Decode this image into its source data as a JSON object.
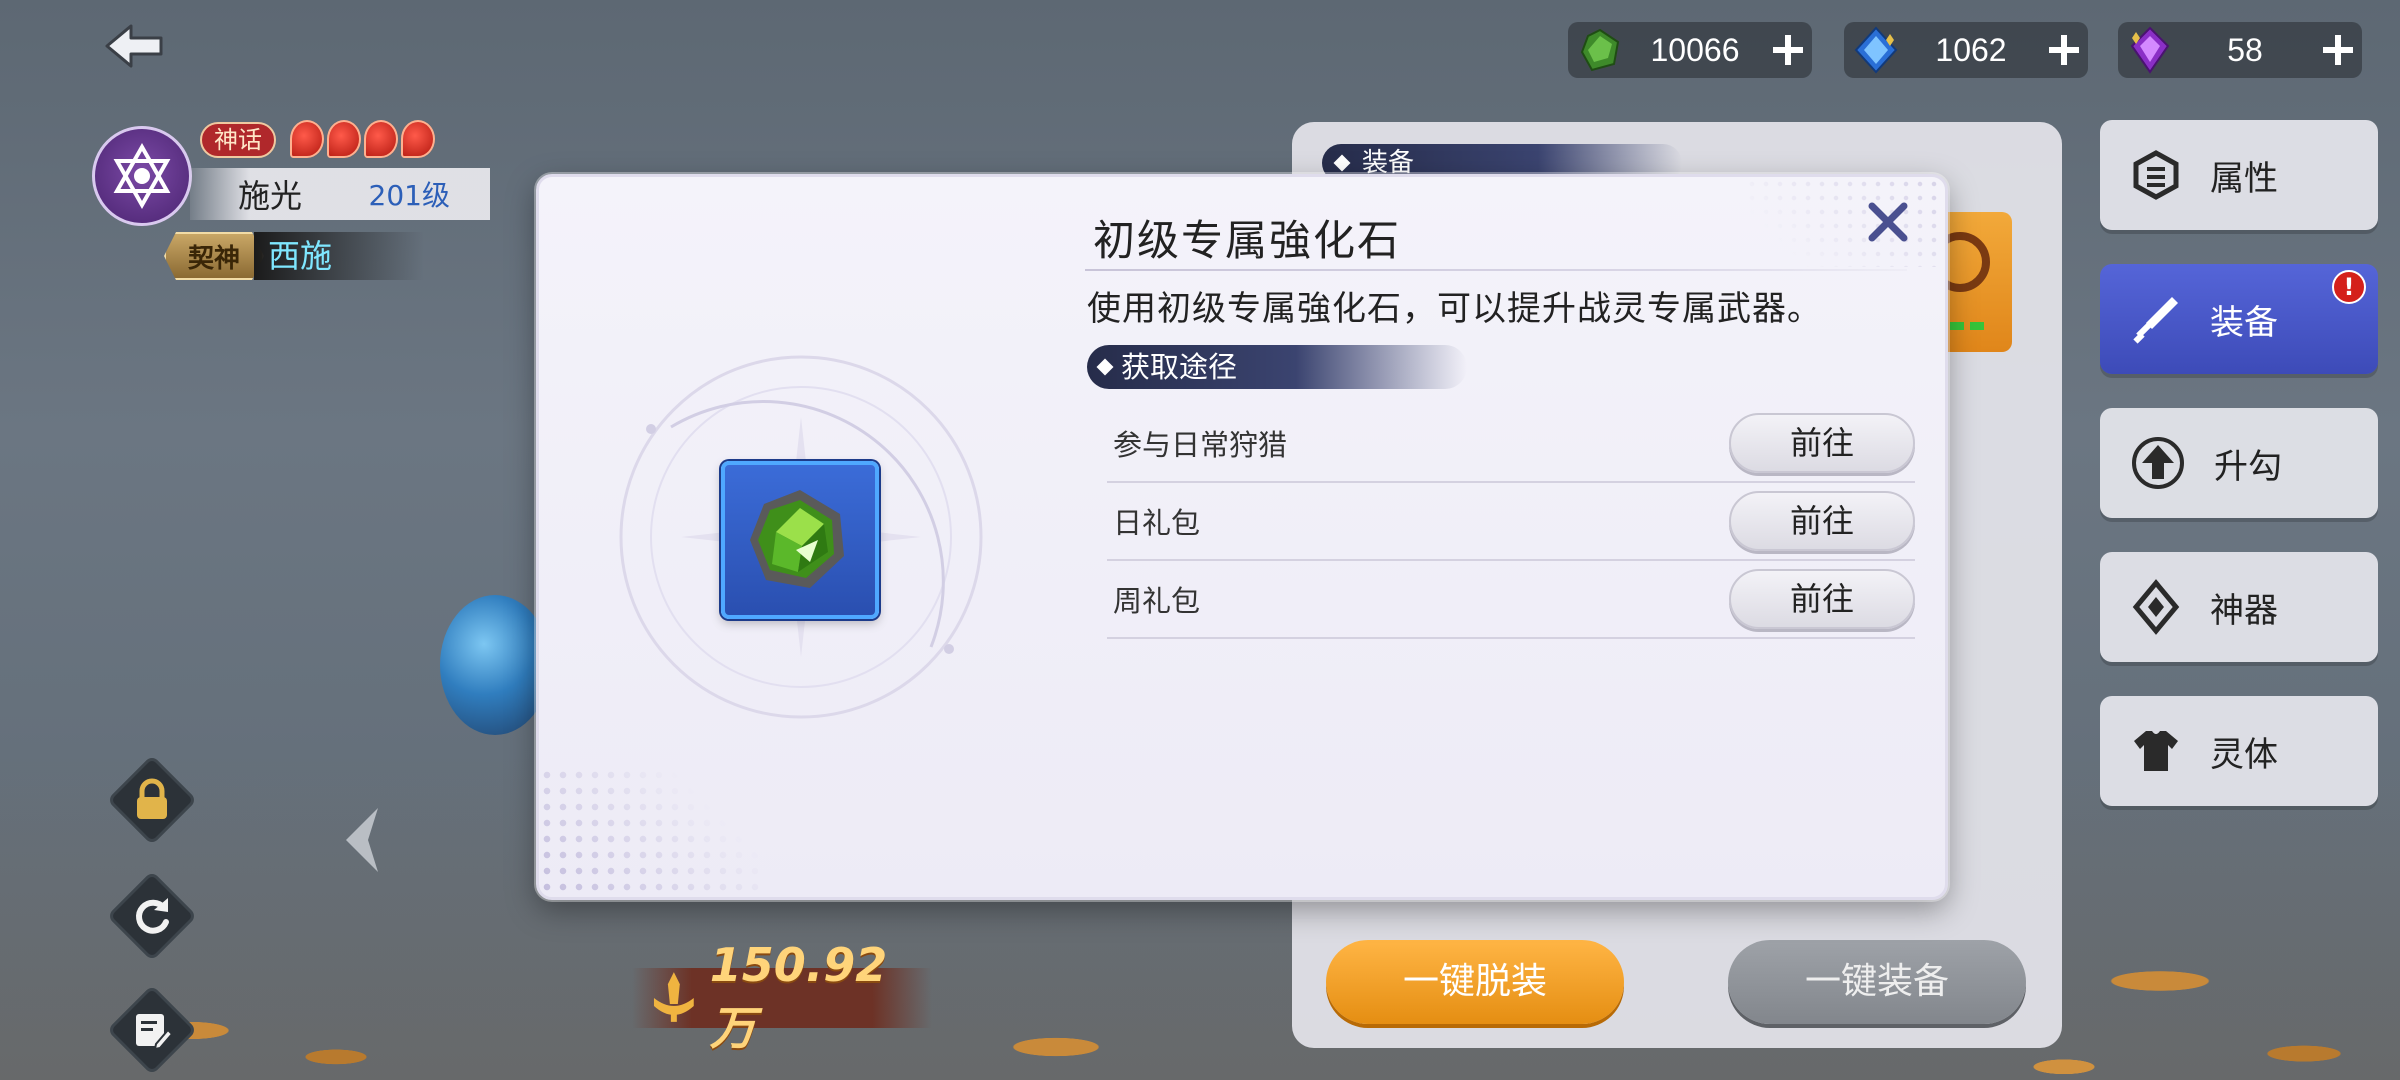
{
  "character": {
    "rank_badge": "神话",
    "star_count": 4,
    "name": "施光",
    "level": "201级",
    "bond_label": "契神",
    "bond_name": "西施"
  },
  "power": {
    "value": "150.92万"
  },
  "currencies": [
    {
      "icon": "green-stone-icon",
      "value": "10066"
    },
    {
      "icon": "blue-crystal-icon",
      "value": "1062"
    },
    {
      "icon": "purple-gem-icon",
      "value": "58"
    }
  ],
  "equipment_panel": {
    "header": "装备",
    "unequip_all_label": "一键脱装",
    "equip_all_label": "一键装备"
  },
  "tabs": [
    {
      "label": "属性",
      "icon": "attribute-icon",
      "active": false
    },
    {
      "label": "装备",
      "icon": "sword-icon",
      "active": true,
      "alert": "!"
    },
    {
      "label": "升勾",
      "icon": "upgrade-arrow-icon",
      "active": false
    },
    {
      "label": "神器",
      "icon": "artifact-icon",
      "active": false
    },
    {
      "label": "灵体",
      "icon": "shirt-icon",
      "active": false
    }
  ],
  "modal": {
    "title": "初级专属強化石",
    "description": "使用初级专属強化石，可以提升战灵专属武器。",
    "source_header": "获取途径",
    "sources": [
      {
        "name": "参与日常狩猎",
        "button": "前往"
      },
      {
        "name": "日礼包",
        "button": "前往"
      },
      {
        "name": "周礼包",
        "button": "前往"
      }
    ]
  },
  "colors": {
    "accent_blue": "#3d4bb8",
    "orange_button": "#e58e12",
    "header_navy": "#262c4a",
    "alert_red": "#d4201a"
  }
}
